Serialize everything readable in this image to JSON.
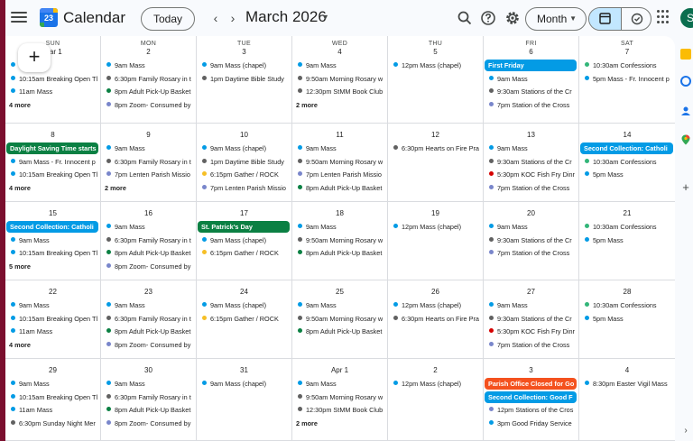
{
  "header": {
    "app_title": "Calendar",
    "logo_number": "23",
    "today_label": "Today",
    "prev_label": "‹",
    "next_label": "›",
    "month_label": "March 2026",
    "view_label": "Month",
    "avatar_letter": "S",
    "icons": [
      "menu-icon",
      "search-icon",
      "help-icon",
      "settings-icon",
      "apps-icon"
    ]
  },
  "create_label": "+",
  "colors": {
    "blue": "#039be5",
    "green": "#0b8043",
    "gray": "#616161",
    "purple": "#7986cb",
    "teal": "#33b679",
    "orange": "#f4511e",
    "banana": "#f6bf26",
    "red": "#d50000"
  },
  "weekdays": [
    "SUN",
    "MON",
    "TUE",
    "WED",
    "THU",
    "FRI",
    "SAT"
  ],
  "weeks": [
    [
      {
        "day": "Mar 1",
        "events": [
          {
            "t": "9am Mass",
            "c": "blue"
          },
          {
            "t": "10:15am Breaking Open Tl",
            "c": "blue"
          },
          {
            "t": "11am Mass",
            "c": "blue"
          }
        ],
        "more": "4 more"
      },
      {
        "day": "2",
        "events": [
          {
            "t": "9am Mass",
            "c": "blue"
          },
          {
            "t": "6:30pm Family Rosary in t",
            "c": "gray"
          },
          {
            "t": "8pm Adult Pick-Up Basket",
            "c": "green"
          },
          {
            "t": "8pm Zoom- Consumed by",
            "c": "purple"
          }
        ]
      },
      {
        "day": "3",
        "events": [
          {
            "t": "9am Mass (chapel)",
            "c": "blue"
          },
          {
            "t": "1pm Daytime Bible Study",
            "c": "gray"
          }
        ]
      },
      {
        "day": "4",
        "events": [
          {
            "t": "9am Mass",
            "c": "blue"
          },
          {
            "t": "9:50am Morning Rosary w",
            "c": "gray"
          },
          {
            "t": "12:30pm StMM Book Club",
            "c": "gray"
          }
        ],
        "more": "2 more"
      },
      {
        "day": "5",
        "events": [
          {
            "t": "12pm Mass (chapel)",
            "c": "blue"
          }
        ]
      },
      {
        "day": "6",
        "events": [
          {
            "t": "First Friday",
            "c": "blue",
            "block": true
          },
          {
            "t": "9am Mass",
            "c": "blue"
          },
          {
            "t": "9:30am Stations of the Cr",
            "c": "gray"
          },
          {
            "t": "7pm Station of the Cross",
            "c": "purple"
          }
        ]
      },
      {
        "day": "7",
        "events": [
          {
            "t": "10:30am Confessions",
            "c": "teal"
          },
          {
            "t": "5pm Mass - Fr. Innocent p",
            "c": "blue"
          }
        ]
      }
    ],
    [
      {
        "day": "8",
        "events": [
          {
            "t": "Daylight Saving Time starts",
            "c": "green",
            "block": true
          },
          {
            "t": "9am Mass - Fr. Innocent p",
            "c": "blue"
          },
          {
            "t": "10:15am Breaking Open Tl",
            "c": "blue"
          }
        ],
        "more": "4 more"
      },
      {
        "day": "9",
        "events": [
          {
            "t": "9am Mass",
            "c": "blue"
          },
          {
            "t": "6:30pm Family Rosary in t",
            "c": "gray"
          },
          {
            "t": "7pm Lenten Parish Missio",
            "c": "purple"
          }
        ],
        "more": "2 more"
      },
      {
        "day": "10",
        "events": [
          {
            "t": "9am Mass (chapel)",
            "c": "blue"
          },
          {
            "t": "1pm Daytime Bible Study",
            "c": "gray"
          },
          {
            "t": "6:15pm Gather / ROCK",
            "c": "banana"
          },
          {
            "t": "7pm Lenten Parish Missio",
            "c": "purple"
          }
        ]
      },
      {
        "day": "11",
        "events": [
          {
            "t": "9am Mass",
            "c": "blue"
          },
          {
            "t": "9:50am Morning Rosary w",
            "c": "gray"
          },
          {
            "t": "7pm Lenten Parish Missio",
            "c": "purple"
          },
          {
            "t": "8pm Adult Pick-Up Basket",
            "c": "green"
          }
        ]
      },
      {
        "day": "12",
        "events": [
          {
            "t": "6:30pm Hearts on Fire Pra",
            "c": "gray"
          }
        ]
      },
      {
        "day": "13",
        "events": [
          {
            "t": "9am Mass",
            "c": "blue"
          },
          {
            "t": "9:30am Stations of the Cr",
            "c": "gray"
          },
          {
            "t": "5:30pm KOC Fish Fry Dinr",
            "c": "red"
          },
          {
            "t": "7pm Station of the Cross",
            "c": "purple"
          }
        ]
      },
      {
        "day": "14",
        "events": [
          {
            "t": "Second Collection: Catholi",
            "c": "blue",
            "block": true
          },
          {
            "t": "10:30am Confessions",
            "c": "teal"
          },
          {
            "t": "5pm Mass",
            "c": "blue"
          }
        ]
      }
    ],
    [
      {
        "day": "15",
        "events": [
          {
            "t": "Second Collection: Catholi",
            "c": "blue",
            "block": true
          },
          {
            "t": "9am Mass",
            "c": "blue"
          },
          {
            "t": "10:15am Breaking Open Tl",
            "c": "blue"
          }
        ],
        "more": "5 more"
      },
      {
        "day": "16",
        "events": [
          {
            "t": "9am Mass",
            "c": "blue"
          },
          {
            "t": "6:30pm Family Rosary in t",
            "c": "gray"
          },
          {
            "t": "8pm Adult Pick-Up Basket",
            "c": "green"
          },
          {
            "t": "8pm Zoom- Consumed by",
            "c": "purple"
          }
        ]
      },
      {
        "day": "17",
        "events": [
          {
            "t": "St. Patrick's Day",
            "c": "green",
            "block": true
          },
          {
            "t": "9am Mass (chapel)",
            "c": "blue"
          },
          {
            "t": "6:15pm Gather / ROCK",
            "c": "banana"
          }
        ]
      },
      {
        "day": "18",
        "events": [
          {
            "t": "9am Mass",
            "c": "blue"
          },
          {
            "t": "9:50am Morning Rosary w",
            "c": "gray"
          },
          {
            "t": "8pm Adult Pick-Up Basket",
            "c": "green"
          }
        ]
      },
      {
        "day": "19",
        "events": [
          {
            "t": "12pm Mass (chapel)",
            "c": "blue"
          }
        ]
      },
      {
        "day": "20",
        "events": [
          {
            "t": "9am Mass",
            "c": "blue"
          },
          {
            "t": "9:30am Stations of the Cr",
            "c": "gray"
          },
          {
            "t": "7pm Station of the Cross",
            "c": "purple"
          }
        ]
      },
      {
        "day": "21",
        "events": [
          {
            "t": "10:30am Confessions",
            "c": "teal"
          },
          {
            "t": "5pm Mass",
            "c": "blue"
          }
        ]
      }
    ],
    [
      {
        "day": "22",
        "events": [
          {
            "t": "9am Mass",
            "c": "blue"
          },
          {
            "t": "10:15am Breaking Open Tl",
            "c": "blue"
          },
          {
            "t": "11am Mass",
            "c": "blue"
          }
        ],
        "more": "4 more"
      },
      {
        "day": "23",
        "events": [
          {
            "t": "9am Mass",
            "c": "blue"
          },
          {
            "t": "6:30pm Family Rosary in t",
            "c": "gray"
          },
          {
            "t": "8pm Adult Pick-Up Basket",
            "c": "green"
          },
          {
            "t": "8pm Zoom- Consumed by",
            "c": "purple"
          }
        ]
      },
      {
        "day": "24",
        "events": [
          {
            "t": "9am Mass (chapel)",
            "c": "blue"
          },
          {
            "t": "6:15pm Gather / ROCK",
            "c": "banana"
          }
        ]
      },
      {
        "day": "25",
        "events": [
          {
            "t": "9am Mass",
            "c": "blue"
          },
          {
            "t": "9:50am Morning Rosary w",
            "c": "gray"
          },
          {
            "t": "8pm Adult Pick-Up Basket",
            "c": "green"
          }
        ]
      },
      {
        "day": "26",
        "events": [
          {
            "t": "12pm Mass (chapel)",
            "c": "blue"
          },
          {
            "t": "6:30pm Hearts on Fire Pra",
            "c": "gray"
          }
        ]
      },
      {
        "day": "27",
        "events": [
          {
            "t": "9am Mass",
            "c": "blue"
          },
          {
            "t": "9:30am Stations of the Cr",
            "c": "gray"
          },
          {
            "t": "5:30pm KOC Fish Fry Dinr",
            "c": "red"
          },
          {
            "t": "7pm Station of the Cross",
            "c": "purple"
          }
        ]
      },
      {
        "day": "28",
        "events": [
          {
            "t": "10:30am Confessions",
            "c": "teal"
          },
          {
            "t": "5pm Mass",
            "c": "blue"
          }
        ]
      }
    ],
    [
      {
        "day": "29",
        "events": [
          {
            "t": "9am Mass",
            "c": "blue"
          },
          {
            "t": "10:15am Breaking Open Tl",
            "c": "blue"
          },
          {
            "t": "11am Mass",
            "c": "blue"
          },
          {
            "t": "6:30pm Sunday Night Mer",
            "c": "gray"
          }
        ]
      },
      {
        "day": "30",
        "events": [
          {
            "t": "9am Mass",
            "c": "blue"
          },
          {
            "t": "6:30pm Family Rosary in t",
            "c": "gray"
          },
          {
            "t": "8pm Adult Pick-Up Basket",
            "c": "green"
          },
          {
            "t": "8pm Zoom- Consumed by",
            "c": "purple"
          }
        ]
      },
      {
        "day": "31",
        "events": [
          {
            "t": "9am Mass (chapel)",
            "c": "blue"
          }
        ]
      },
      {
        "day": "Apr 1",
        "events": [
          {
            "t": "9am Mass",
            "c": "blue"
          },
          {
            "t": "9:50am Morning Rosary w",
            "c": "gray"
          },
          {
            "t": "12:30pm StMM Book Club",
            "c": "gray"
          }
        ],
        "more": "2 more"
      },
      {
        "day": "2",
        "events": [
          {
            "t": "12pm Mass (chapel)",
            "c": "blue"
          }
        ]
      },
      {
        "day": "3",
        "events": [
          {
            "t": "Parish Office Closed for Go",
            "c": "orange",
            "block": true
          },
          {
            "t": "Second Collection: Good F",
            "c": "blue",
            "block": true
          },
          {
            "t": "12pm Stations of the Cros",
            "c": "purple"
          },
          {
            "t": "3pm Good Friday Service",
            "c": "blue"
          }
        ]
      },
      {
        "day": "4",
        "events": [
          {
            "t": "8:30pm Easter Vigil Mass",
            "c": "blue"
          }
        ]
      }
    ]
  ],
  "side_icons": [
    "keep-icon",
    "tasks-icon",
    "contacts-icon",
    "maps-icon",
    "add-icon"
  ],
  "side_add_label": "+"
}
